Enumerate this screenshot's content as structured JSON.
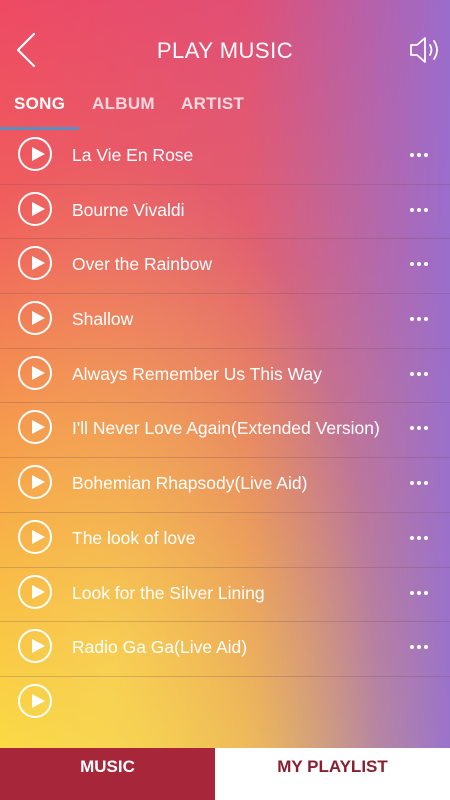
{
  "header": {
    "title": "PLAY MUSIC",
    "back_icon": "chevron-left-icon",
    "speaker_icon": "speaker-volume-icon"
  },
  "tabs": [
    {
      "label": "SONG",
      "active": true
    },
    {
      "label": "ALBUM",
      "active": false
    },
    {
      "label": "ARTIST",
      "active": false
    }
  ],
  "songs": [
    "La Vie En Rose",
    "Bourne Vivaldi",
    "Over the Rainbow",
    "Shallow",
    "Always Remember Us This Way",
    "I'll Never Love Again(Extended Version)",
    "Bohemian Rhapsody(Live Aid)",
    "The look of love",
    "Look for the Silver Lining",
    "Radio Ga Ga(Live Aid)"
  ],
  "bottom_nav": {
    "music_label": "MUSIC",
    "playlist_label": "MY PLAYLIST"
  },
  "colors": {
    "active_tab_indicator": "#5a8fc0",
    "music_button_bg": "#a8263a",
    "playlist_text": "#8a1e2e"
  }
}
